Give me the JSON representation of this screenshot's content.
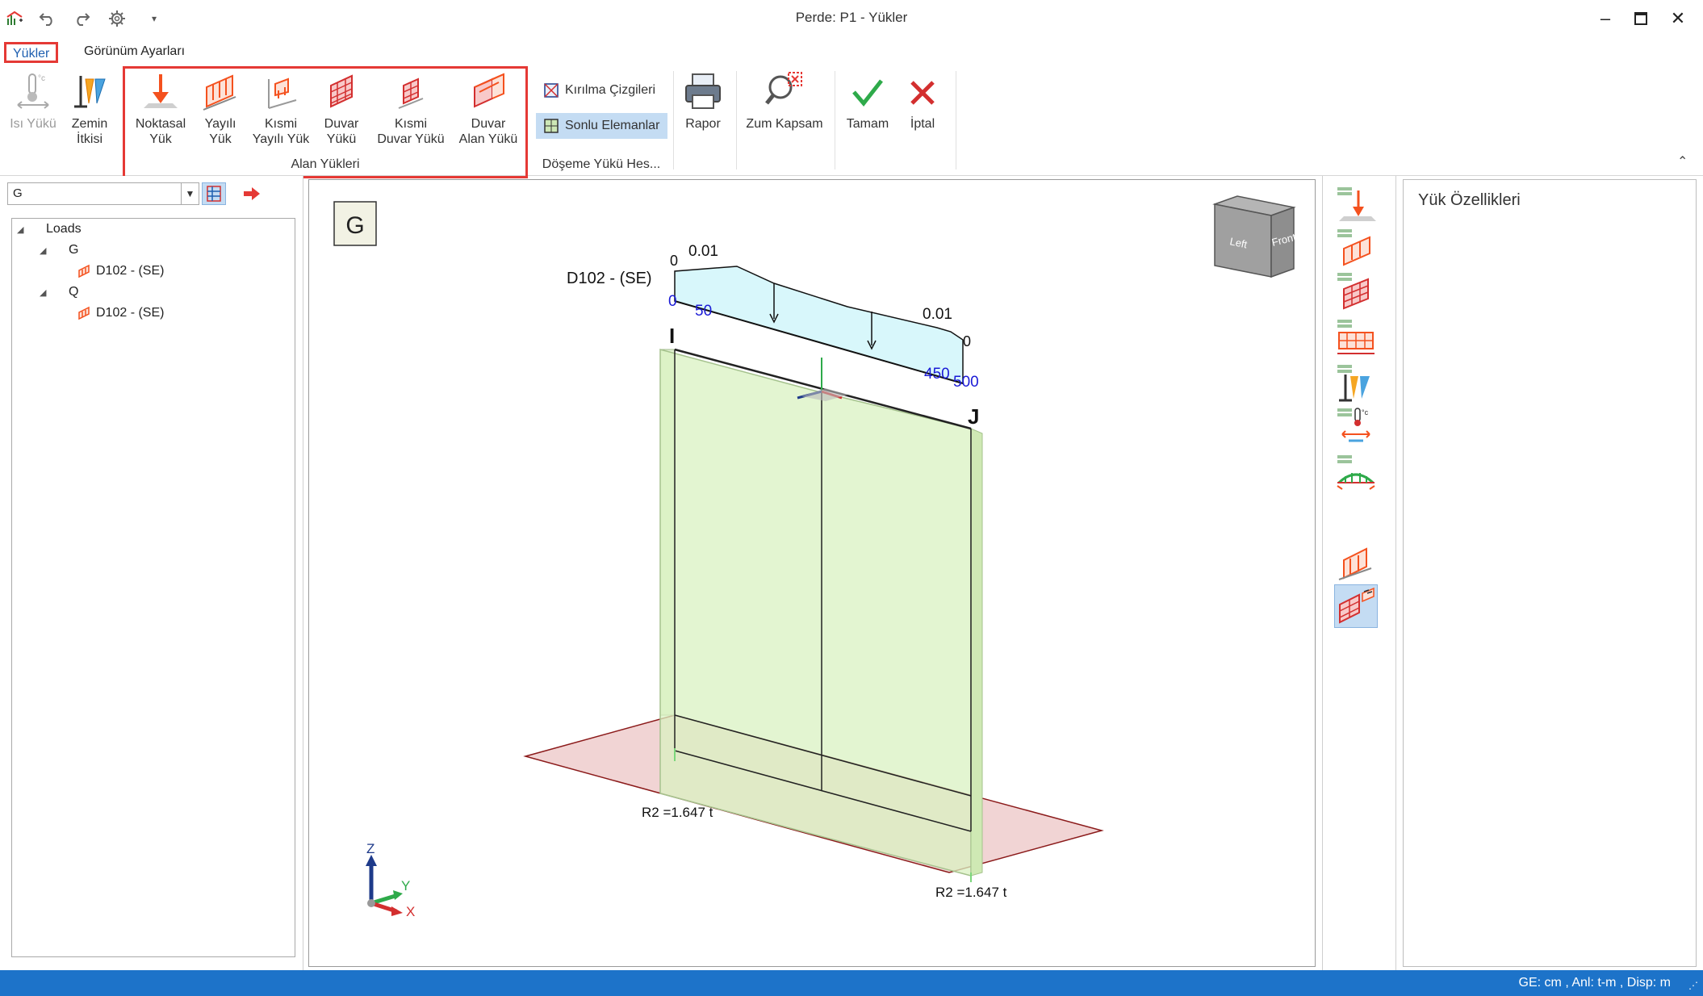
{
  "window": {
    "title": "Perde: P1 - Yükler"
  },
  "tabs": [
    {
      "label": "Yükler",
      "active": true
    },
    {
      "label": "Görünüm Ayarları",
      "active": false
    }
  ],
  "ribbon": {
    "heat_load": {
      "line1": "Isı Yükü",
      "line2": ""
    },
    "ground_effect": {
      "line1": "Zemin",
      "line2": "İtkisi"
    },
    "point_load": {
      "line1": "Noktasal",
      "line2": "Yük"
    },
    "distributed_load": {
      "line1": "Yayılı",
      "line2": "Yük"
    },
    "partial_distributed_load": {
      "line1": "Kısmi",
      "line2": "Yayılı Yük"
    },
    "wall_load": {
      "line1": "Duvar",
      "line2": "Yükü"
    },
    "partial_wall_load": {
      "line1": "Kısmi",
      "line2": "Duvar Yükü"
    },
    "wall_area_load": {
      "line1": "Duvar",
      "line2": "Alan Yükü"
    },
    "group_area_loads": "Alan Yükleri",
    "break_lines": "Kırılma Çizgileri",
    "finite_elements": "Sonlu Elemanlar",
    "group_slab_calc": "Döşeme Yükü Hes...",
    "report": "Rapor",
    "zoom_extents": "Zum Kapsam",
    "ok": "Tamam",
    "cancel": "İptal"
  },
  "left_panel": {
    "combo_value": "G",
    "tree": {
      "root": "Loads",
      "groups": [
        {
          "name": "G",
          "items": [
            "D102 - (SE)"
          ]
        },
        {
          "name": "Q",
          "items": [
            "D102 - (SE)"
          ]
        }
      ]
    }
  },
  "viewport": {
    "case_badge": "G",
    "load_name": "D102 - (SE)",
    "values": {
      "v_start": "0",
      "v_left": "0.01",
      "v_right": "0.01",
      "v_end": "0"
    },
    "positions": {
      "p0": "0",
      "p50": "50",
      "p450": "450",
      "p500": "500"
    },
    "node_i": "I",
    "node_j": "J",
    "reaction_left": "R2 =1.647 t",
    "reaction_right": "R2 =1.647 t",
    "viewcube": {
      "left": "Left",
      "front": "Front"
    },
    "axes": {
      "z": "Z",
      "y": "Y",
      "x": "X"
    }
  },
  "properties": {
    "title": "Yük Özellikleri"
  },
  "status": {
    "units": "GE: cm , Anl: t-m , Disp: m"
  },
  "colors": {
    "accent": "#1e5fb0",
    "highlight_box": "#e53935",
    "status_bar": "#1d73c9",
    "wall_fill": "#d9f2c2",
    "load_fill": "#d8f7fb",
    "base_plane": "#e8b8b8"
  }
}
